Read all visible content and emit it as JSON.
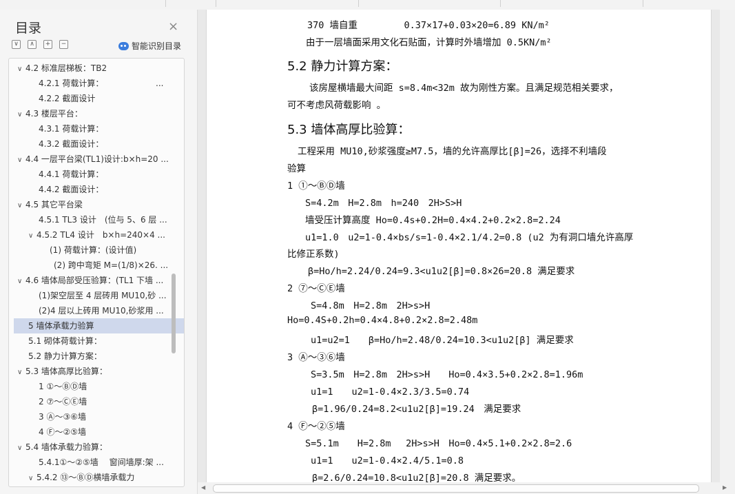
{
  "sidebar": {
    "title": "目录",
    "close_glyph": "×",
    "tools": [
      "∨",
      "∧",
      "+",
      "−"
    ],
    "smart_label": "智能识别目录",
    "items": [
      {
        "text": "4.2 标准层梯板：TB2",
        "caret": "∨",
        "dots": ""
      },
      {
        "text": "4.2.1 荷载计算：",
        "caret": "",
        "dots": "..."
      },
      {
        "text": "4.2.2 截面设计",
        "caret": "",
        "dots": ""
      },
      {
        "text": "4.3 楼层平台：",
        "caret": "∨",
        "dots": ""
      },
      {
        "text": "4.3.1 荷载计算：",
        "caret": "",
        "dots": ""
      },
      {
        "text": "4.3.2 截面设计：",
        "caret": "",
        "dots": ""
      },
      {
        "text": "4.4 一层平台梁(TL1)设计:b×h=20 ...",
        "caret": "∨",
        "dots": ""
      },
      {
        "text": "4.4.1 荷载计算：",
        "caret": "",
        "dots": ""
      },
      {
        "text": "4.4.2 截面设计：",
        "caret": "",
        "dots": ""
      },
      {
        "text": "4.5 其它平台梁",
        "caret": "∨",
        "dots": ""
      },
      {
        "text": "4.5.1 TL3 设计　(位与 5、6 层 ...",
        "caret": "",
        "dots": ""
      },
      {
        "text": "4.5.2 TL4 设计　b×h=240×4 ...",
        "caret": "∨",
        "dots": ""
      },
      {
        "text": "(1) 荷载计算：(设计值)",
        "caret": "",
        "dots": ""
      },
      {
        "text": "(2) 跨中弯矩 M=(1/8)×26. ...",
        "caret": "",
        "dots": ""
      },
      {
        "text": "4.6 墙体局部受压验算：(TL1 下墙 ...",
        "caret": "∨",
        "dots": ""
      },
      {
        "text": "(1)架空层至 4 层砖用 MU10,砂 ...",
        "caret": "",
        "dots": ""
      },
      {
        "text": "(2)4 层以上砖用 MU10,砂浆用 ...",
        "caret": "",
        "dots": ""
      },
      {
        "text": "5 墙体承载力验算",
        "caret": "",
        "dots": ""
      },
      {
        "text": "5.1 砌体荷载计算：",
        "caret": "",
        "dots": ""
      },
      {
        "text": "5.2 静力计算方案：",
        "caret": "",
        "dots": ""
      },
      {
        "text": "5.3 墙体高厚比验算：",
        "caret": "∨",
        "dots": ""
      },
      {
        "text": "1 ①～ⒷⒹ墙",
        "caret": "",
        "dots": ""
      },
      {
        "text": "2 ⑦～ⒸⒺ墙",
        "caret": "",
        "dots": ""
      },
      {
        "text": "3 Ⓐ～③⑥墙",
        "caret": "",
        "dots": ""
      },
      {
        "text": "4 Ⓕ～②⑤墙",
        "caret": "",
        "dots": ""
      },
      {
        "text": "5.4 墙体承载力验算：",
        "caret": "∨",
        "dots": ""
      },
      {
        "text": "5.4.1①～②⑤墙　 窗间墙厚:架 ...",
        "caret": "",
        "dots": ""
      },
      {
        "text": "5.4.2 ⑬～ⒷⒹ横墙承载力",
        "caret": "∨",
        "dots": ""
      }
    ]
  },
  "document": {
    "lines": [
      "370 墙自重　　　　　0.37×17+0.03×20=6.89 KN/m²",
      "由于一层墙面采用文化石贴面，计算时外墙增加 0.5KN/m²",
      "5.2 静力计算方案：",
      "该房屋横墙最大间距 s=8.4m<32m 故为刚性方案。且满足规范相关要求，",
      "可不考虑风荷载影响 。",
      "5.3 墙体高厚比验算：",
      "工程采用 MU10,砂浆强度≥M7.5，墙的允许高厚比[β]=26，选择不利墙段",
      "验算",
      "1 ①～ⒷⒹ墙",
      "S=4.2m　H=2.8m　h=240　2H>S>H",
      "墙受压计算高度 Ho=0.4s+0.2H=0.4×4.2+0.2×2.8=2.24",
      "u1=1.0　u2=1-0.4×bs/s=1-0.4×2.1/4.2=0.8 (u2 为有洞口墙允许高厚",
      "比修正系数)",
      "β=Ho/h=2.24/0.24=9.3<u1u2[β]=0.8×26=20.8 满足要求",
      "2 ⑦～ⒸⒺ墙",
      "S=4.8m　H=2.8m　2H>s>H",
      "Ho=0.4S+0.2h=0.4×4.8+0.2×2.8=2.48m",
      "u1=u2=1　　β=Ho/h=2.48/0.24=10.3<u1u2[β] 满足要求",
      "3 Ⓐ～③⑥墙",
      "S=3.5m　H=2.8m　2H>s>H　　Ho=0.4×3.5+0.2×2.8=1.96m",
      "u1=1　　u2=1-0.4×2.3/3.5=0.74",
      "β=1.96/0.24=8.2<u1u2[β]=19.24　满足要求",
      "4 Ⓕ～②⑤墙",
      "S=5.1m　　H=2.8m　 2H>s>H　Ho=0.4×5.1+0.2×2.8=2.6",
      "u1=1　　u2=1-0.4×2.4/5.1=0.8",
      "β=2.6/0.24=10.8<u1u2[β]=20.8 满足要求。"
    ]
  }
}
